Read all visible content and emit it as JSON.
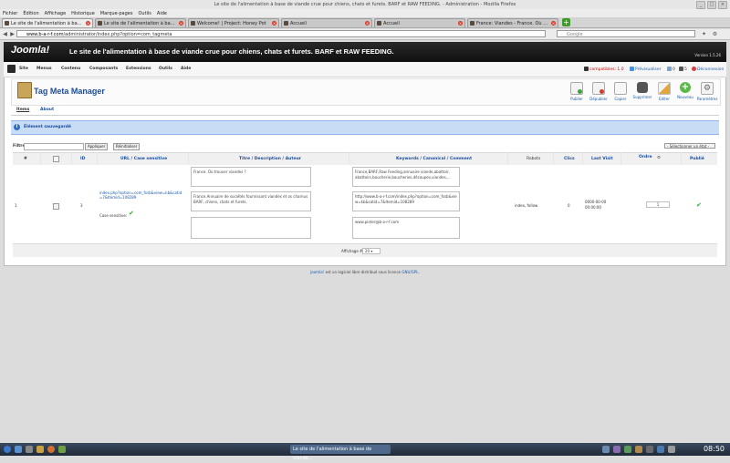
{
  "window": {
    "title": "Le site de l'alimentation à base de viande crue pour chiens, chats et furets. BARF et RAW FEEDING. - Administration - Mozilla Firefox",
    "min": "_",
    "max": "□",
    "close": "×"
  },
  "menu": [
    "Fichier",
    "Édition",
    "Affichage",
    "Historique",
    "Marque-pages",
    "Outils",
    "Aide"
  ],
  "tabs": [
    {
      "label": "Le site de l'alimentation à base de..."
    },
    {
      "label": "Le site de l'alimentation à base d..."
    },
    {
      "label": "Welcome! | Project: Honey Pot"
    },
    {
      "label": "Accueil"
    },
    {
      "label": "Accueil"
    },
    {
      "label": "France: Viandes - France. Où trou..."
    }
  ],
  "newtab": "+",
  "nav": {
    "back": "◀",
    "forward": "▶",
    "url_host": "www.b-a-r-f.com",
    "url_path": "/administrator/index.php?option=com_tagmeta",
    "search_placeholder": "Google"
  },
  "joomla": {
    "logo": "Joomla!",
    "site_title": "Le site de l'alimentation à base de viande crue pour chiens, chats et furets. BARF et RAW FEEDING.",
    "version": "Version 1.5.26",
    "menu": [
      "Site",
      "Menus",
      "Contenu",
      "Composants",
      "Extensions",
      "Outils",
      "Aide"
    ],
    "status": {
      "compat": "compatibles: 1.0",
      "preview": "Prévisualiser",
      "msgs": "0",
      "users": "5",
      "logout": "Déconnexion"
    }
  },
  "component": {
    "title": "Tag Meta Manager",
    "toolbar": [
      "Publier",
      "Dépublier",
      "Copier",
      "Supprimer",
      "Editer",
      "Nouveau",
      "Paramètres"
    ],
    "subtabs": [
      "Items",
      "About"
    ],
    "message": "Élément sauvegardé"
  },
  "filter": {
    "label": "Filtre :",
    "apply": "Appliquer",
    "reset": "Réinitialiser",
    "state": "- Sélectionner un état -"
  },
  "table": {
    "headers": {
      "num": "#",
      "id": "ID",
      "url": "URL / Case sensitive",
      "title": "Titre / Description / Auteur",
      "keywords": "Keywords / Canonical / Comment",
      "robots": "Robots",
      "clics": "Clics",
      "lastvisit": "Last Visit",
      "ordre": "Ordre",
      "publie": "Publié"
    },
    "row": {
      "num": "1",
      "id": "3",
      "url": "index.php?option=com_fssb&view=kb&catid=7&Itemid=108289",
      "case_label": "Case sensitive:",
      "title": "France. Où trouver viandes ?",
      "description": "France.Annuaire de sociétés fournissant viandes et os charnus BARF, chiens, chats et furets.",
      "author": "",
      "keywords": "France,BARF,Raw Feeding,annuaire viande,abattoir, abattoirs,boucherie,boucheries,découpes,viandes,...",
      "canonical": "http://www.b-a-r-f.com/index.php?option=com_fssb&view=kb&catid=7&Itemid=108289",
      "comment": "www.pieter@b-a-r-f.com",
      "robots": "index, follow",
      "clics": "0",
      "lastvisit": "0000-00-00 00:00:00",
      "ordre": "1"
    }
  },
  "pagination": {
    "label": "Affichage #",
    "value": "20"
  },
  "footer": {
    "link1": "Joomla!",
    "text": " est un logiciel libre distribué sous licence ",
    "link2": "GNU/GPL",
    "end": "."
  },
  "taskbar": {
    "active_task": "Le site de l'alimentation à base de viande...",
    "clock": "08:50"
  }
}
